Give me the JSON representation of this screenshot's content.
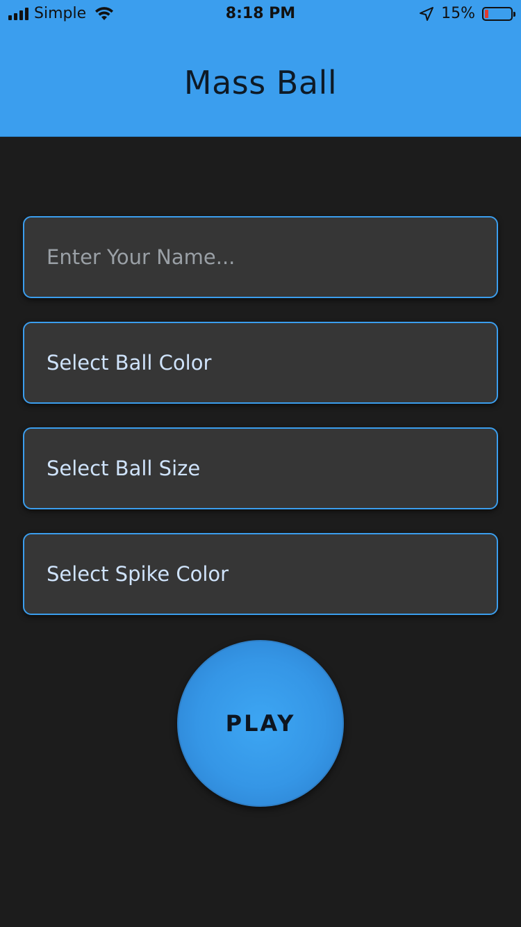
{
  "status_bar": {
    "carrier": "Simple",
    "time": "8:18 PM",
    "battery_percent": "15%",
    "battery_level": 0.15,
    "battery_color": "#e23b2e",
    "icons": [
      "signal-bars-icon",
      "wifi-icon",
      "location-arrow-icon",
      "battery-icon"
    ]
  },
  "header": {
    "title": "Mass Ball",
    "background_color": "#3b9eee"
  },
  "form": {
    "name_placeholder": "Enter Your Name...",
    "name_value": "",
    "ball_color_label": "Select Ball Color",
    "ball_size_label": "Select Ball Size",
    "spike_color_label": "Select Spike Color",
    "field_border_color": "#3b9eee"
  },
  "play_button": {
    "label": "PLAY",
    "color": "#3596e6"
  },
  "background_color": "#1c1c1c"
}
